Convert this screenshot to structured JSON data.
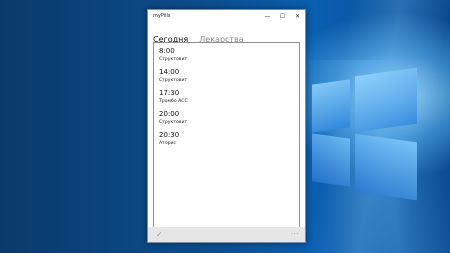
{
  "window": {
    "title": "myPills",
    "min_glyph": "—",
    "max_glyph": "☐",
    "close_glyph": "✕"
  },
  "tabs": [
    {
      "label": "Сегодня",
      "active": true
    },
    {
      "label": "Лекарства",
      "active": false
    }
  ],
  "schedule": [
    {
      "time": "8:00",
      "drug": "Структовит"
    },
    {
      "time": "14:00",
      "drug": "Структовит"
    },
    {
      "time": "17:30",
      "drug": "Тромбо АСС"
    },
    {
      "time": "20:00",
      "drug": "Структовит"
    },
    {
      "time": "20:30",
      "drug": "Аторис"
    }
  ],
  "appbar": {
    "confirm_glyph": "✓",
    "more_glyph": "..."
  },
  "colors": {
    "desktop": "#0c4d8d",
    "accent": "#0078d7",
    "appbar": "#e6e6e6"
  }
}
